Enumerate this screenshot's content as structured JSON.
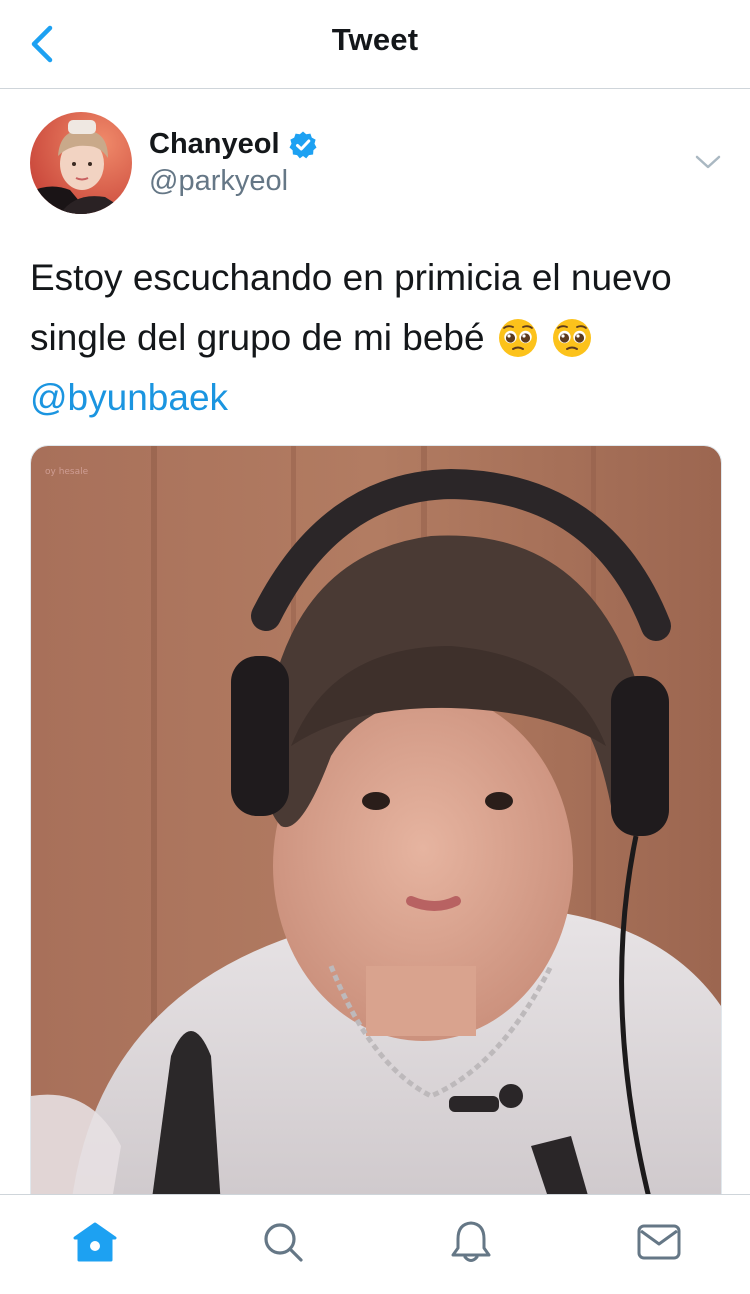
{
  "header": {
    "title": "Tweet",
    "back_icon": "chevron-left-icon"
  },
  "author": {
    "name": "Chanyeol",
    "handle": "@parkyeol",
    "verified": true,
    "verified_icon": "verified-badge-icon"
  },
  "tweet": {
    "text_line1": "Estoy escuchando en primicia el nuevo",
    "text_line2": "single del grupo de mi bebé",
    "emoji": [
      "pleading-face-emoji",
      "pleading-face-emoji"
    ],
    "mention": "@byunbaek"
  },
  "media": {
    "watermark": "oy hesale"
  },
  "tabbar": {
    "items": [
      {
        "name": "home",
        "icon": "home-icon",
        "active": true
      },
      {
        "name": "search",
        "icon": "search-icon",
        "active": false
      },
      {
        "name": "notifications",
        "icon": "bell-icon",
        "active": false
      },
      {
        "name": "messages",
        "icon": "mail-icon",
        "active": false
      }
    ]
  },
  "colors": {
    "accent": "#1da1f2",
    "link": "#1b95e0",
    "secondary_text": "#657786",
    "divider": "#cfd5da"
  }
}
